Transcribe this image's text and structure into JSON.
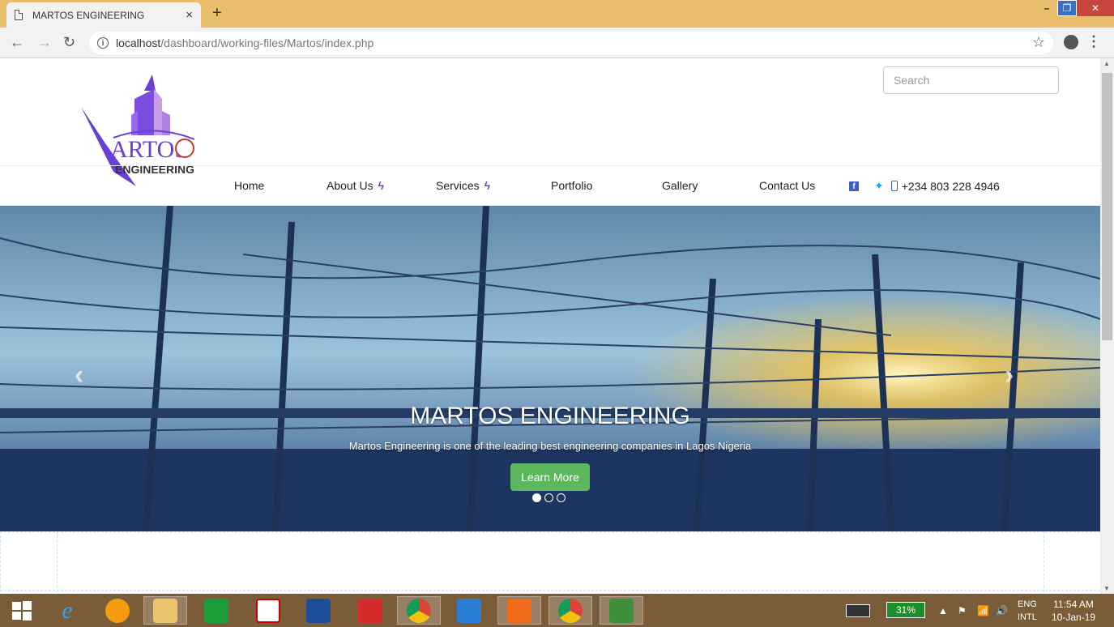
{
  "browser": {
    "tab_title": "MARTOS ENGINEERING",
    "tab_close": "×",
    "new_tab": "+",
    "url_host": "localhost",
    "url_path": "/dashboard/working-files/Martos/index.php",
    "window_min": "–",
    "window_max": "❐",
    "window_close": "✕"
  },
  "site": {
    "logo_text": "ARTOS",
    "logo_sub": "ENGINEERING",
    "search_placeholder": "Search",
    "nav": {
      "home": "Home",
      "about": "About Us",
      "services": "Services",
      "portfolio": "Portfolio",
      "gallery": "Gallery",
      "contact": "Contact Us"
    },
    "phone": "+234 803 228 4946",
    "colors": {
      "accent": "#6a3fd6",
      "button": "#5cb85c",
      "facebook": "#3b5ec8",
      "twitter": "#1da1f2"
    }
  },
  "hero": {
    "title": "MARTOS ENGINEERING",
    "subtitle": "Martos Engineering is one of the leading best engineering companies in Lagos Nigeria",
    "button": "Learn More",
    "slides": 3,
    "active_slide": 1,
    "prev": "‹",
    "next": "›"
  },
  "taskbar": {
    "battery": "31%",
    "lang_line1": "ENG",
    "lang_line2": "INTL",
    "time": "11:54 AM",
    "date": "10-Jan-19",
    "apps": [
      "start-icon",
      "ie-icon",
      "headphones-icon",
      "file-explorer-icon",
      "store-icon",
      "adobe-icon",
      "lenovo-icon",
      "box-icon",
      "chrome-icon",
      "brackets-icon",
      "xampp-icon",
      "chrome-icon",
      "app-icon"
    ]
  }
}
